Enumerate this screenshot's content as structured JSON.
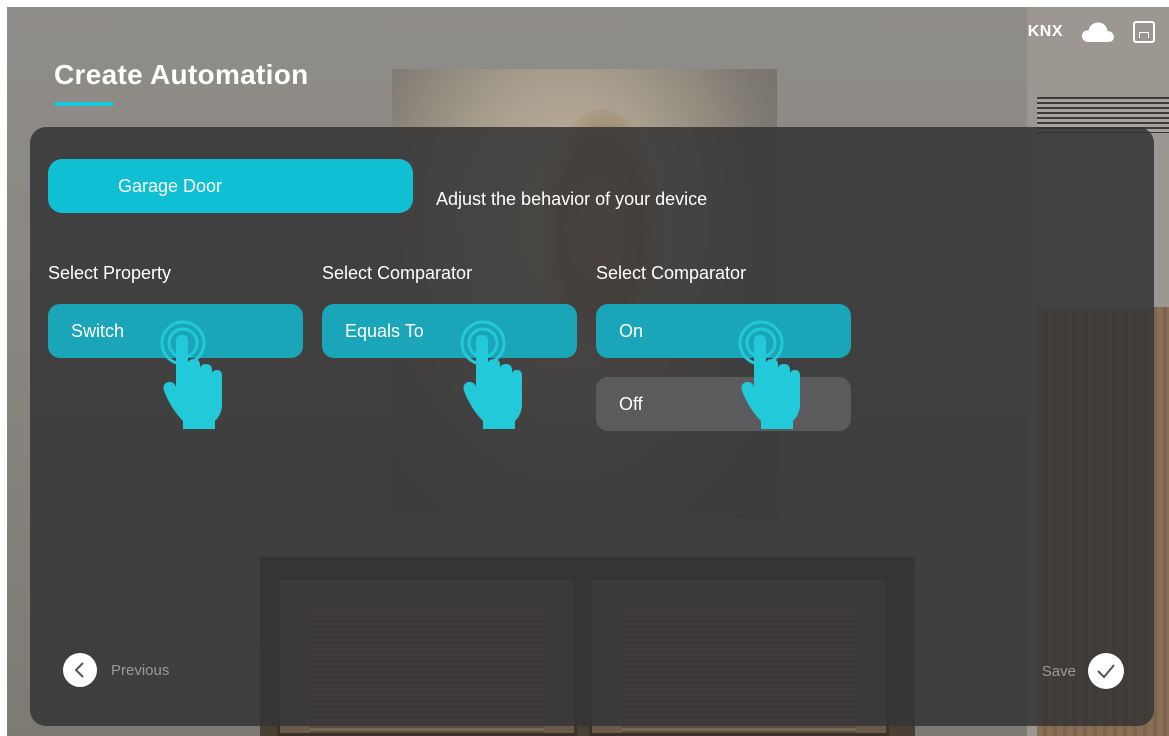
{
  "status_bar": {
    "protocol_label": "KNX",
    "icons": [
      "cloud-icon",
      "home-icon"
    ]
  },
  "page": {
    "title": "Create Automation"
  },
  "device": {
    "name": "Garage Door",
    "description": "Adjust the behavior of your device"
  },
  "columns": [
    {
      "label": "Select Property",
      "options": [
        {
          "label": "Switch",
          "selected": true
        }
      ]
    },
    {
      "label": "Select Comparator",
      "options": [
        {
          "label": "Equals To",
          "selected": true
        }
      ]
    },
    {
      "label": "Select Comparator",
      "options": [
        {
          "label": "On",
          "selected": true
        },
        {
          "label": "Off",
          "selected": false
        }
      ]
    }
  ],
  "navigation": {
    "previous_label": "Previous",
    "save_label": "Save"
  },
  "colors": {
    "accent": "#0fbfd4",
    "selected": "#1ba5b9",
    "unselected": "#5b5b5d",
    "panel": "#343436",
    "tap_hint": "#22c9d8"
  }
}
